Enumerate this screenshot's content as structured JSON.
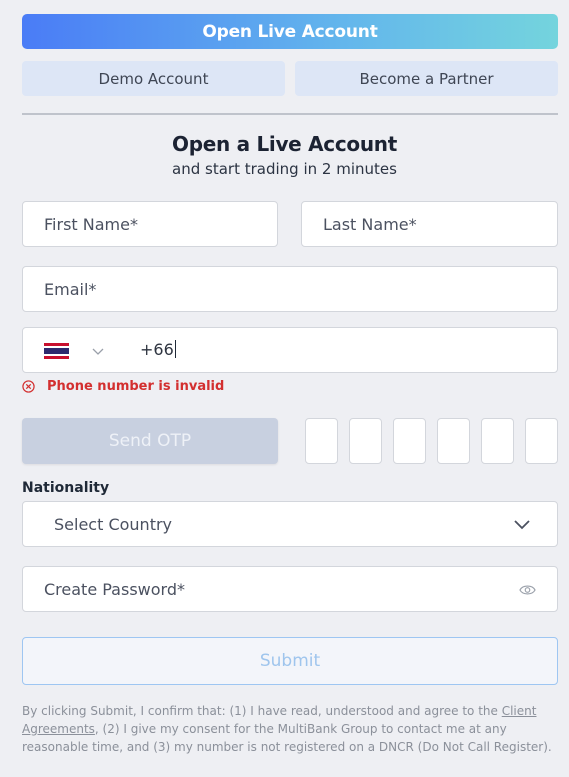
{
  "header": {
    "primary_button": "Open Live Account",
    "tabs": [
      "Demo Account",
      "Become a Partner"
    ]
  },
  "form": {
    "title": "Open a Live Account",
    "subtitle": "and start trading in 2 minutes",
    "first_name_placeholder": "First Name*",
    "last_name_placeholder": "Last Name*",
    "email_placeholder": "Email*",
    "phone": {
      "country_flag": "thailand-flag-icon",
      "value": "+66",
      "error": "Phone number is invalid"
    },
    "send_otp_label": "Send OTP",
    "otp_digit_count": 6,
    "nationality_label": "Nationality",
    "country_placeholder": "Select Country",
    "password_placeholder": "Create Password*",
    "submit_label": "Submit"
  },
  "legal": {
    "part1": "By clicking Submit, I confirm that: (1) I have read, understood and agree to the ",
    "link": "Client Agreements",
    "part2": ", (2) I give my consent for the MultiBank Group to contact me at any reasonable time, and (3) my number is not registered on a DNCR (Do Not Call Register)."
  },
  "colors": {
    "error": "#d32f2f",
    "gradient_start": "#4a7cf6",
    "gradient_end": "#74d4dd",
    "tab_bg": "#dde6f6",
    "submit_border": "#9ec6f2"
  }
}
